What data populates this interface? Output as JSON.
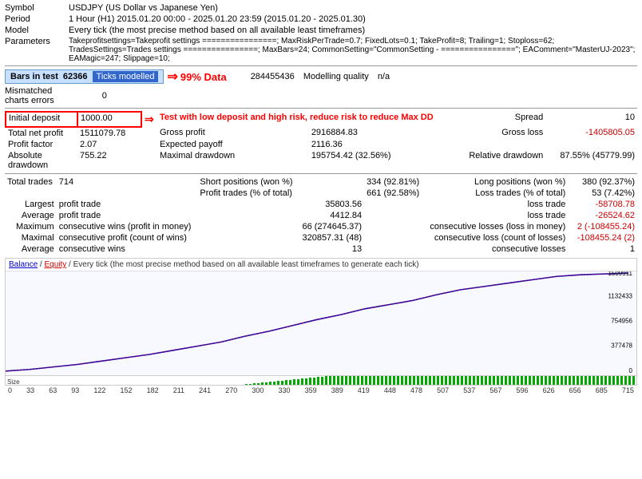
{
  "header": {
    "symbol": "USDJPY (US Dollar vs Japanese Yen)",
    "period": "1 Hour (H1) 2015.01.20 00:00 - 2025.01.20 23:59 (2015.01.20 - 2025.01.30)",
    "model": "Every tick (the most precise method based on all available least timeframes)",
    "parameters": "Takeprofitsettings=Takeprofit settings ================; MaxRiskPerTrade=0.7; FixedLots=0.1; TakeProfit=8; Trailing=1; Stoploss=62; TradesSettings=Trades settings ================; MaxBars=24; CommonSetting=\"CommonSetting - ================\"; EAComment=\"MasterUJ-2023\"; EAMagic=247; Slippage=10;"
  },
  "stats": {
    "bars_in_test": "62366",
    "data_percentage": "99% Data",
    "ticks_count": "284455436",
    "modelling_quality": "n/a",
    "mismatched": "0",
    "initial_deposit": "1000.00",
    "spread": "10",
    "total_net_profit": "1511079.78",
    "gross_profit": "2916884.83",
    "gross_loss": "-1405805.05",
    "profit_factor": "2.07",
    "expected_payoff": "2116.36",
    "absolute_drawdown": "755.22",
    "maximal_drawdown": "195754.42 (32.56%)",
    "relative_drawdown": "87.55% (45779.99)"
  },
  "annotations": {
    "deposit": "Test with low deposit and high risk, reduce risk to reduce Max DD"
  },
  "trades": {
    "total": "714",
    "short_positions": "334 (92.81%)",
    "long_positions": "380 (92.37%)",
    "profit_trades": "661 (92.58%)",
    "loss_trades": "53 (7.42%)",
    "largest_profit": "35803.56",
    "largest_loss": "-58708.78",
    "average_profit": "4412.84",
    "average_loss": "-26524.62",
    "max_consec_wins": "66 (274645.37)",
    "max_consec_losses": "2 (-108455.24)",
    "maximal_consec_profit": "320857.31 (48)",
    "maximal_consec_loss": "-108455.24 (2)",
    "average_consec_wins": "13",
    "average_consec_losses": "1"
  },
  "chart": {
    "description": "Every tick (the most precise method based on all available least timeframes to generate each tick)",
    "y_labels": [
      "1509911",
      "1132433",
      "754956",
      "377478",
      "0"
    ],
    "x_labels": [
      "0",
      "33",
      "63",
      "93",
      "122",
      "152",
      "182",
      "211",
      "241",
      "270",
      "300",
      "330",
      "359",
      "389",
      "419",
      "448",
      "478",
      "507",
      "537",
      "567",
      "596",
      "626",
      "656",
      "685",
      "715"
    ]
  }
}
